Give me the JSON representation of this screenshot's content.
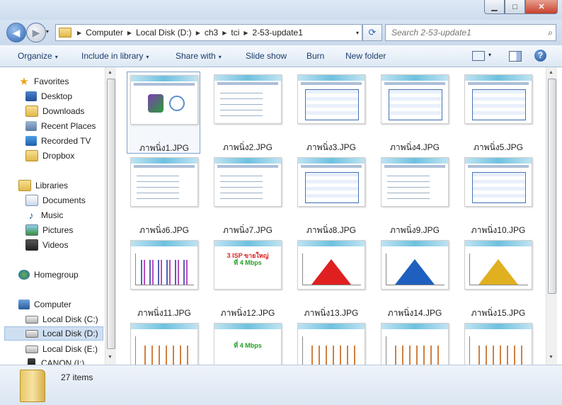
{
  "window": {
    "minimize_glyph": "▁",
    "maximize_glyph": "□",
    "close_glyph": "✕"
  },
  "nav": {
    "back_glyph": "◀",
    "forward_glyph": "▶",
    "recent_glyph": "▾"
  },
  "address": {
    "crumbs": [
      "Computer",
      "Local Disk (D:)",
      "ch3",
      "tci",
      "2-53-update1"
    ],
    "separator": "▶",
    "dropdown_glyph": "▾",
    "refresh_glyph": "⟳"
  },
  "search": {
    "placeholder": "Search 2-53-update1",
    "icon": "search-icon",
    "icon_glyph": "⌕"
  },
  "toolbar": {
    "organize": "Organize",
    "include_in_library": "Include in library",
    "share_with": "Share with",
    "slide_show": "Slide show",
    "burn": "Burn",
    "new_folder": "New folder",
    "dropdown_glyph": "▾",
    "help_glyph": "?"
  },
  "sidebar": {
    "favorites": {
      "header": "Favorites",
      "items": [
        "Desktop",
        "Downloads",
        "Recent Places",
        "Recorded TV",
        "Dropbox"
      ]
    },
    "libraries": {
      "header": "Libraries",
      "items": [
        "Documents",
        "Music",
        "Pictures",
        "Videos"
      ]
    },
    "homegroup": "Homegroup",
    "computer": {
      "header": "Computer",
      "items": [
        "Local Disk (C:)",
        "Local Disk (D:)",
        "Local Disk (E:)",
        "CANON (I:)"
      ],
      "selected": "Local Disk (D:)"
    },
    "star_glyph": "★",
    "music_glyph": "♪"
  },
  "files": [
    {
      "name": "ภาพนิ่ง1.JPG",
      "kind": "title"
    },
    {
      "name": "ภาพนิ่ง2.JPG",
      "kind": "text"
    },
    {
      "name": "ภาพนิ่ง3.JPG",
      "kind": "table"
    },
    {
      "name": "ภาพนิ่ง4.JPG",
      "kind": "table"
    },
    {
      "name": "ภาพนิ่ง5.JPG",
      "kind": "table"
    },
    {
      "name": "ภาพนิ่ง6.JPG",
      "kind": "text"
    },
    {
      "name": "ภาพนิ่ง7.JPG",
      "kind": "text"
    },
    {
      "name": "ภาพนิ่ง8.JPG",
      "kind": "table"
    },
    {
      "name": "ภาพนิ่ง9.JPG",
      "kind": "text"
    },
    {
      "name": "ภาพนิ่ง10.JPG",
      "kind": "table"
    },
    {
      "name": "ภาพนิ่ง11.JPG",
      "kind": "bars"
    },
    {
      "name": "ภาพนิ่ง12.JPG",
      "kind": "banner",
      "line1": "3 ISP ขายใหญ่",
      "line2": "ที่ 4 Mbps"
    },
    {
      "name": "ภาพนิ่ง13.JPG",
      "kind": "peak",
      "color": "#e02020"
    },
    {
      "name": "ภาพนิ่ง14.JPG",
      "kind": "peak",
      "color": "#1f5fc0"
    },
    {
      "name": "ภาพนิ่ง15.JPG",
      "kind": "peak",
      "color": "#e0b020"
    },
    {
      "name": "",
      "kind": "cbars"
    },
    {
      "name": "",
      "kind": "banner",
      "line1": "",
      "line2": "ที่ 4 Mbps"
    },
    {
      "name": "",
      "kind": "cbars"
    },
    {
      "name": "",
      "kind": "cbars"
    },
    {
      "name": "",
      "kind": "cbars"
    }
  ],
  "selected_file": "ภาพนิ่ง1.JPG",
  "status": {
    "item_count": "27 items"
  },
  "colors": {
    "accent": "#2b65b4",
    "selection": "#cfdff2"
  }
}
